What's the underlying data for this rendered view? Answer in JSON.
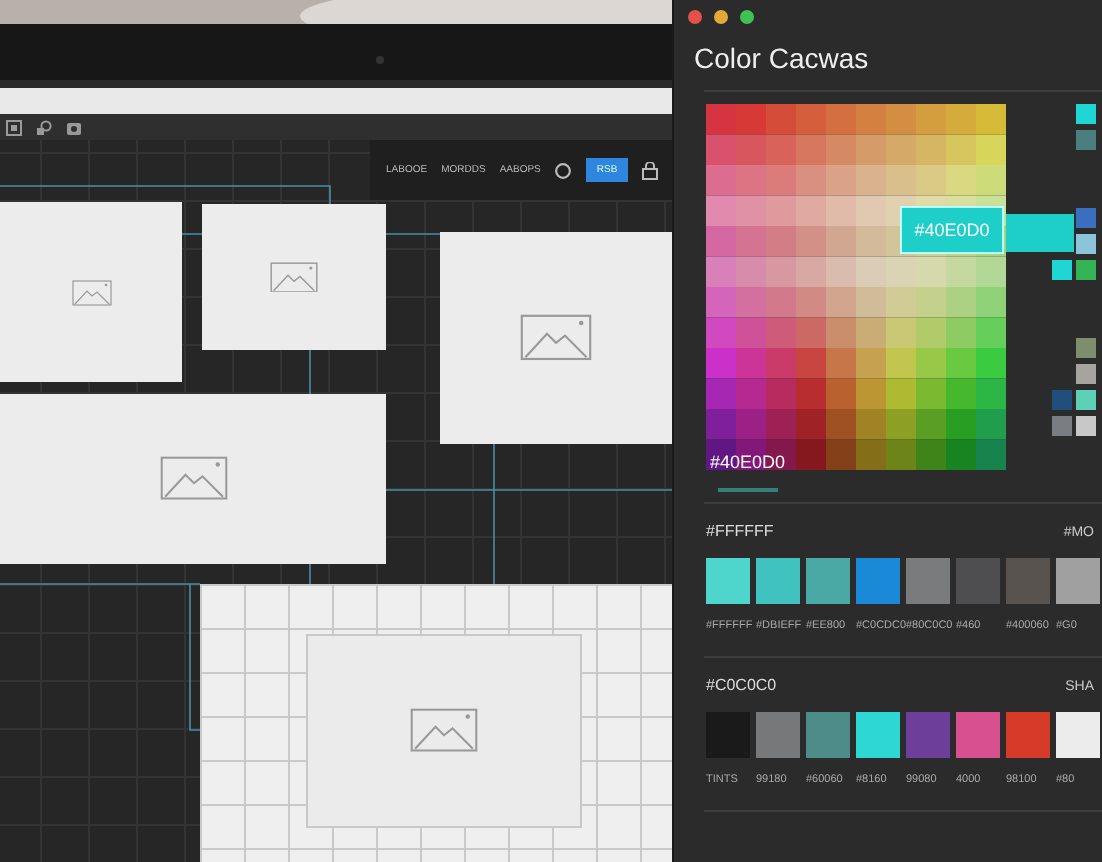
{
  "window": {
    "controls": [
      {
        "color": "#e5504a"
      },
      {
        "color": "#e2a93a"
      },
      {
        "color": "#3fc153"
      }
    ]
  },
  "toolbar": {
    "tools": [
      "LABOOE",
      "MORDDS",
      "AABOPS"
    ],
    "button": "RSB"
  },
  "panel": {
    "title": "Color Cacwas",
    "picker": {
      "hex": "#40E0D0",
      "tooltip": "#40E0D0"
    },
    "side_swatches": [
      {
        "color": "#1ed6d4"
      },
      {
        "color": "#4a7f80"
      },
      {
        "color": "#3a6fc0"
      },
      {
        "color": "#8cc4dc"
      },
      {
        "color": "#1ed6d4"
      },
      {
        "color": "#33b556"
      },
      {
        "color": "#7d8d6e"
      },
      {
        "color": "#a7a39e"
      },
      {
        "color": "#1f4f7a"
      },
      {
        "color": "#5dd0b8"
      },
      {
        "color": "#7a7d84"
      },
      {
        "color": "#c8c8c8"
      }
    ],
    "sections": [
      {
        "title": "#FFFFFF",
        "aside": "#MO",
        "swatches": [
          {
            "color": "#4fd6cc",
            "label": "#FFFFFF"
          },
          {
            "color": "#3fc2c0",
            "label": "#DBIEFF"
          },
          {
            "color": "#4aa9a5",
            "label": "#EE800"
          },
          {
            "color": "#1a8ad8",
            "label": "#C0CDC0"
          },
          {
            "color": "#7a7b7d",
            "label": "#80C0C0"
          },
          {
            "color": "#4e4e50",
            "label": "#460"
          },
          {
            "color": "#58534f",
            "label": "#400060"
          },
          {
            "color": "#a0a0a0",
            "label": "#G0"
          }
        ]
      },
      {
        "title": "#C0C0C0",
        "aside": "SHA",
        "swatches": [
          {
            "color": "#1a1a1a",
            "label": "TINTS"
          },
          {
            "color": "#767879",
            "label": "99180"
          },
          {
            "color": "#4d8c88",
            "label": "#60060"
          },
          {
            "color": "#2dd8d4",
            "label": "#8160"
          },
          {
            "color": "#6e3f9a",
            "label": "99080"
          },
          {
            "color": "#d8508f",
            "label": "4000"
          },
          {
            "color": "#d83a2a",
            "label": "98100"
          },
          {
            "color": "#ececec",
            "label": "#80"
          }
        ]
      }
    ]
  }
}
